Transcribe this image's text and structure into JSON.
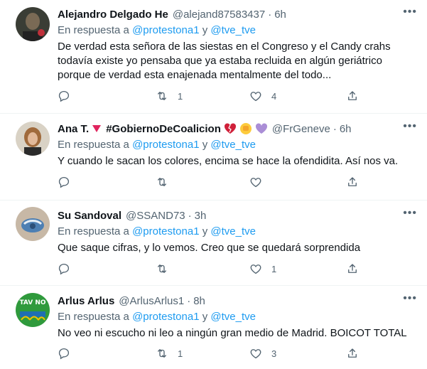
{
  "reply_prefix": "En respuesta a",
  "reply_and": "y",
  "more_glyph": "•••",
  "tweets": [
    {
      "name": "Alejandro Delgado He",
      "handle": "@alejand87583437",
      "time": "6h",
      "mentions": [
        "@protestona1",
        "@tve_tve"
      ],
      "text": "De verdad esta señora de las siestas en el Congreso y el Candy crahs todavía existe yo pensaba que ya estaba recluida en algún geriátrico porque de verdad esta enajenada mentalmente del todo...",
      "reply_count": "",
      "retweet_count": "1",
      "like_count": "4"
    },
    {
      "name": "Ana T.",
      "hashtag": "#GobiernoDeCoalicion",
      "handle": "@FrGeneve",
      "time": "6h",
      "mentions": [
        "@protestona1",
        "@tve_tve"
      ],
      "text": "Y cuando le sacan los colores, encima se hace la ofendidita. Así nos va.",
      "reply_count": "",
      "retweet_count": "",
      "like_count": ""
    },
    {
      "name": "Su Sandoval",
      "handle": "@SSAND73",
      "time": "3h",
      "mentions": [
        "@protestona1",
        "@tve_tve"
      ],
      "text": "Que saque cifras, y lo vemos. Creo que se quedará sorprendida",
      "reply_count": "",
      "retweet_count": "",
      "like_count": "1"
    },
    {
      "name": "Arlus Arlus",
      "handle": "@ArlusArlus1",
      "time": "8h",
      "mentions": [
        "@protestona1",
        "@tve_tve"
      ],
      "text": "No veo ni escucho ni leo a ningún gran medio de Madrid. BOICOT TOTAL",
      "reply_count": "",
      "retweet_count": "1",
      "like_count": "3"
    }
  ],
  "avatar4_text": "TAV NO"
}
